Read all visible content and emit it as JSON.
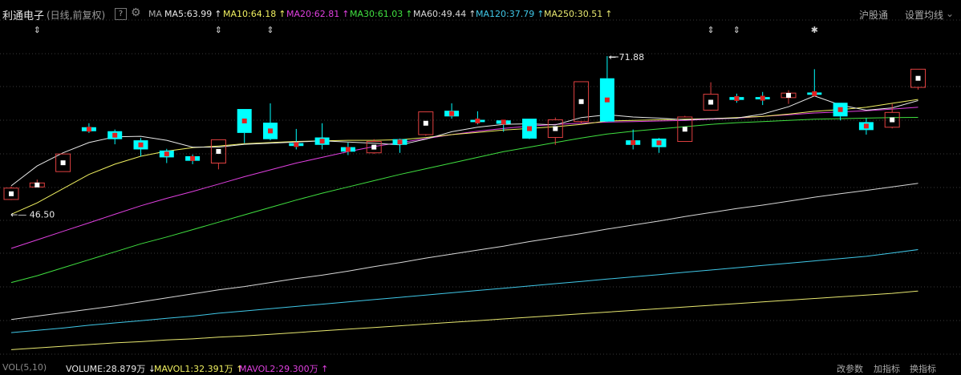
{
  "header": {
    "stock_name": "利通电子",
    "mode": "(日线,前复权)",
    "help": "?",
    "ma_label": "MA",
    "ma_items": [
      {
        "text": "MA5:63.99",
        "arrow": "↑",
        "color": "#e8e8e8"
      },
      {
        "text": "MA10:64.18",
        "arrow": "↑",
        "color": "#f0f060"
      },
      {
        "text": "MA20:62.81",
        "arrow": "↑",
        "color": "#e040e0"
      },
      {
        "text": "MA30:61.03",
        "arrow": "↑",
        "color": "#40e040"
      },
      {
        "text": "MA60:49.44",
        "arrow": "↑",
        "color": "#d8d8d8"
      },
      {
        "text": "MA120:37.79",
        "arrow": "↑",
        "color": "#40c8e8"
      },
      {
        "text": "MA250:30.51",
        "arrow": "↑",
        "color": "#e8e870"
      }
    ],
    "hgt": "沪股通",
    "settings": "设置均线"
  },
  "chart_data": {
    "type": "candlestick",
    "high_label": "71.88",
    "low_label": "46.50",
    "up_color": "#e04040",
    "down_color": "#00ffff",
    "ohlc": [
      [
        46.6,
        48.6,
        46.5,
        48.9
      ],
      [
        48.8,
        49.5,
        48.8,
        50.1
      ],
      [
        51.5,
        54.6,
        51.5,
        54.6
      ],
      [
        59.3,
        58.6,
        58.3,
        60.0
      ],
      [
        58.6,
        57.2,
        56.3,
        58.9
      ],
      [
        57.0,
        55.4,
        54.2,
        57.4
      ],
      [
        55.2,
        54.0,
        53.0,
        55.5
      ],
      [
        54.2,
        53.4,
        52.8,
        54.5
      ],
      [
        53.0,
        57.1,
        51.9,
        57.1
      ],
      [
        62.5,
        58.3,
        56.5,
        62.5
      ],
      [
        60.1,
        57.2,
        57.0,
        63.5
      ],
      [
        56.5,
        56.0,
        55.4,
        59.0
      ],
      [
        57.5,
        56.2,
        55.4,
        60.0
      ],
      [
        55.8,
        55.0,
        54.4,
        56.6
      ],
      [
        54.8,
        56.8,
        54.6,
        57.2
      ],
      [
        57.2,
        56.2,
        54.8,
        57.3
      ],
      [
        58.0,
        62.0,
        57.8,
        62.0
      ],
      [
        62.2,
        61.2,
        60.8,
        63.5
      ],
      [
        60.6,
        60.2,
        59.8,
        62.1
      ],
      [
        60.5,
        59.9,
        58.5,
        60.6
      ],
      [
        60.8,
        57.3,
        57.2,
        60.8
      ],
      [
        57.5,
        60.6,
        56.2,
        61.0
      ],
      [
        60.3,
        67.3,
        60.0,
        67.3
      ],
      [
        67.9,
        60.3,
        60.2,
        71.8
      ],
      [
        57.0,
        56.2,
        55.4,
        58.9
      ],
      [
        57.3,
        55.8,
        54.8,
        57.4
      ],
      [
        56.8,
        61.1,
        56.8,
        61.3
      ],
      [
        62.3,
        65.1,
        62.2,
        67.2
      ],
      [
        64.6,
        64.1,
        63.6,
        65.2
      ],
      [
        64.6,
        64.2,
        63.2,
        65.5
      ],
      [
        64.5,
        65.3,
        63.4,
        65.8
      ],
      [
        65.4,
        65.0,
        64.8,
        69.5
      ],
      [
        63.6,
        61.2,
        60.5,
        63.6
      ],
      [
        60.2,
        58.8,
        58.0,
        60.9
      ],
      [
        59.3,
        61.9,
        59.1,
        63.4
      ],
      [
        66.3,
        69.5,
        65.9,
        69.5
      ]
    ],
    "ma5": [
      49.0,
      52.5,
      54.8,
      56.6,
      57.6,
      57.7,
      57.0,
      55.8,
      55.8,
      56.3,
      56.5,
      56.7,
      56.9,
      56.7,
      56.5,
      56.2,
      57.2,
      58.5,
      59.3,
      59.8,
      59.9,
      59.7,
      61.0,
      61.5,
      61.1,
      60.9,
      60.6,
      60.8,
      60.9,
      61.6,
      62.9,
      64.8,
      63.2,
      62.3,
      62.7,
      63.99
    ],
    "ma10": [
      44.0,
      46.0,
      48.5,
      51.0,
      52.8,
      54.2,
      55.1,
      55.7,
      56.0,
      56.4,
      56.6,
      56.8,
      56.9,
      57.0,
      57.0,
      57.1,
      57.5,
      58.0,
      58.4,
      58.8,
      59.1,
      59.4,
      59.8,
      60.4,
      60.5,
      60.6,
      60.7,
      60.8,
      61.0,
      61.2,
      61.6,
      62.1,
      62.4,
      62.8,
      63.5,
      64.18
    ],
    "ma20": [
      38.0,
      39.5,
      41.0,
      42.5,
      44.0,
      45.5,
      46.8,
      48.0,
      49.3,
      50.6,
      51.8,
      53.0,
      54.0,
      55.0,
      55.9,
      56.6,
      57.3,
      58.0,
      58.6,
      59.1,
      59.5,
      59.8,
      60.0,
      60.2,
      60.3,
      60.4,
      60.5,
      60.7,
      60.9,
      61.2,
      61.5,
      61.8,
      62.0,
      62.2,
      62.5,
      62.81
    ],
    "ma30": [
      32.0,
      33.2,
      34.6,
      36.0,
      37.4,
      38.8,
      40.0,
      41.3,
      42.6,
      43.9,
      45.2,
      46.5,
      47.7,
      48.8,
      49.9,
      51.0,
      52.0,
      53.0,
      54.0,
      55.0,
      55.8,
      56.6,
      57.4,
      58.1,
      58.6,
      59.0,
      59.4,
      59.8,
      60.1,
      60.3,
      60.5,
      60.7,
      60.8,
      60.9,
      61.0,
      61.03
    ],
    "ma60": [
      25.5,
      26.1,
      26.7,
      27.3,
      27.9,
      28.6,
      29.3,
      30.0,
      30.7,
      31.3,
      32.0,
      32.7,
      33.3,
      34.0,
      34.8,
      35.5,
      36.3,
      37.0,
      37.7,
      38.4,
      39.2,
      39.9,
      40.6,
      41.4,
      42.1,
      42.8,
      43.6,
      44.3,
      45.0,
      45.6,
      46.3,
      47.0,
      47.6,
      48.2,
      48.8,
      49.44
    ],
    "ma120": [
      23.2,
      23.6,
      24.0,
      24.5,
      24.9,
      25.3,
      25.7,
      26.1,
      26.6,
      27.0,
      27.4,
      27.8,
      28.2,
      28.6,
      29.0,
      29.4,
      29.8,
      30.2,
      30.6,
      31.0,
      31.4,
      31.8,
      32.2,
      32.6,
      33.0,
      33.4,
      33.8,
      34.2,
      34.6,
      35.0,
      35.4,
      35.8,
      36.2,
      36.6,
      37.2,
      37.79
    ],
    "ma250": [
      20.2,
      20.5,
      20.8,
      21.1,
      21.4,
      21.6,
      21.9,
      22.1,
      22.4,
      22.6,
      22.9,
      23.2,
      23.5,
      23.8,
      24.1,
      24.4,
      24.7,
      25.0,
      25.3,
      25.6,
      25.9,
      26.2,
      26.5,
      26.8,
      27.1,
      27.4,
      27.7,
      28.0,
      28.3,
      28.6,
      28.9,
      29.2,
      29.5,
      29.8,
      30.1,
      30.51
    ],
    "event_markers": [
      "⇕",
      "⇕",
      "⇕",
      "⇕",
      "⇕",
      "✱"
    ]
  },
  "footer": {
    "vol_label": "VOL(5,10)",
    "volume": "VOLUME:28.879万",
    "volume_arrow": "↓",
    "mavol1": "MAVOL1:32.391万",
    "mavol1_arrow": "↑",
    "mavol2": "MAVOL2:29.300万",
    "mavol2_arrow": "↑",
    "btn_params": "改参数",
    "btn_add": "加指标",
    "btn_switch": "换指标"
  }
}
